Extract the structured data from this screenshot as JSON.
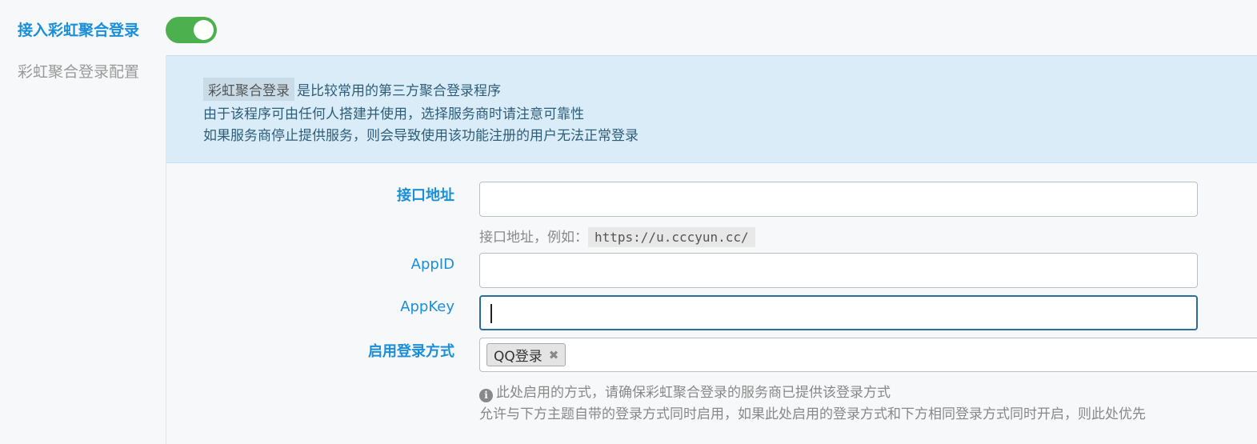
{
  "toggle": {
    "label": "接入彩虹聚合登录",
    "enabled": true
  },
  "config_label": "彩虹聚合登录配置",
  "notice": {
    "chip": "彩虹聚合登录",
    "line1_rest": "是比较常用的第三方聚合登录程序",
    "line2": "由于该程序可由任何人搭建并使用，选择服务商时请注意可靠性",
    "line3": "如果服务商停止提供服务，则会导致使用该功能注册的用户无法正常登录"
  },
  "fields": {
    "api_url": {
      "label": "接口地址",
      "value": "",
      "help_prefix": "接口地址，例如：",
      "help_example": "https://u.cccyun.cc/"
    },
    "appid": {
      "label": "AppID",
      "value": ""
    },
    "appkey": {
      "label": "AppKey",
      "value": ""
    },
    "login_methods": {
      "label": "启用登录方式",
      "selected": [
        "QQ登录"
      ],
      "help1": "此处启用的方式，请确保彩虹聚合登录的服务商已提供该登录方式",
      "help2": "允许与下方主题自带的登录方式同时启用，如果此处启用的登录方式和下方相同登录方式同时开启，则此处优先"
    }
  },
  "icons": {
    "info": "info-circle-icon",
    "remove": "remove-tag-icon"
  },
  "colors": {
    "accent": "#1a8fd9",
    "switch_on": "#4cb04f",
    "notice_bg": "#d9ecf7"
  }
}
